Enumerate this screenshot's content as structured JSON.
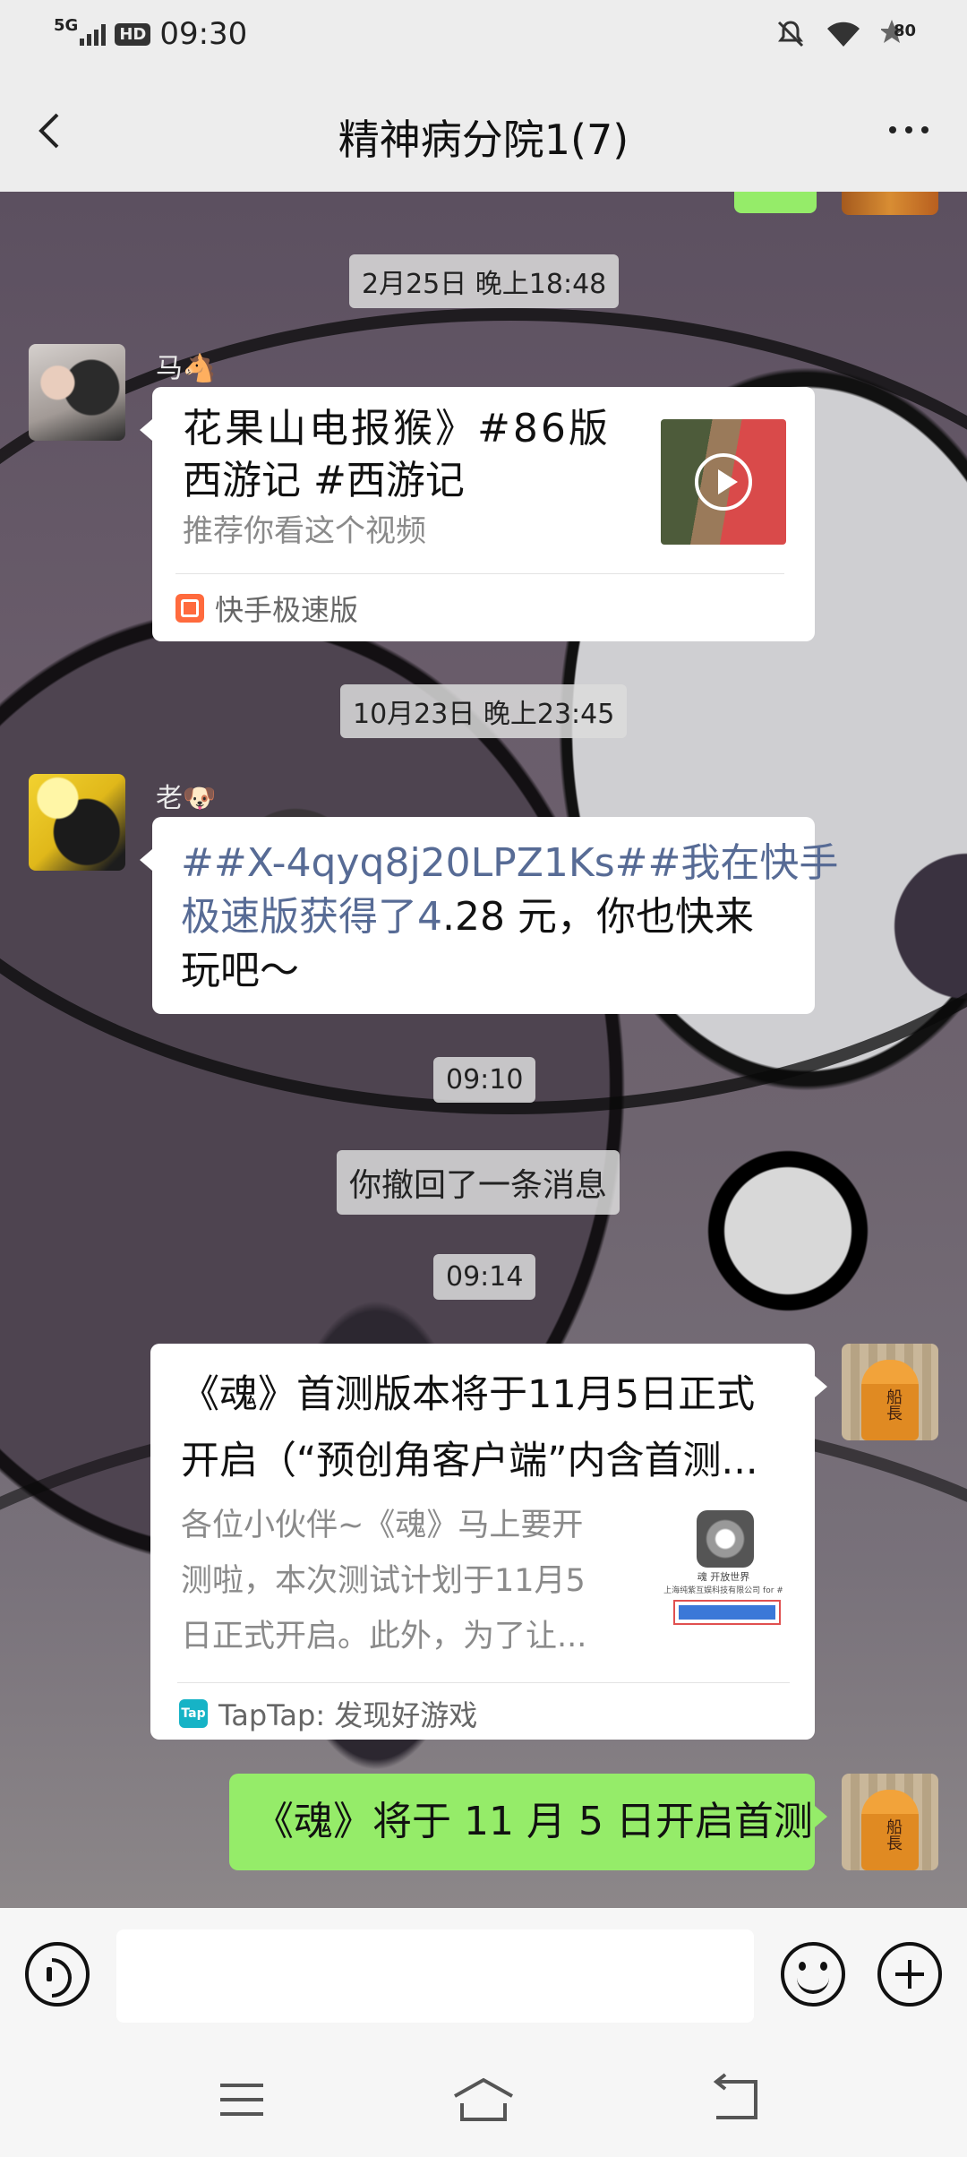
{
  "status_bar": {
    "network": "5G",
    "hd": "HD",
    "time": "09:30",
    "battery": "80"
  },
  "header": {
    "title": "精神病分院1(7)"
  },
  "messages": {
    "ts1": "2月25日 晚上18:48",
    "ma": {
      "sender": "马🐴",
      "title_line1": "花果山电报猴》#86版",
      "title_line2": "西游记 #西游记",
      "desc": "推荐你看这个视频",
      "source": "快手极速版"
    },
    "ts2": "10月23日 晚上23:45",
    "lao": {
      "sender": "老🐶",
      "link1": "##X-4qyq8j20LPZ1Ks#",
      "link2": "#我在快手",
      "link3": "极速版获得了4",
      "text_rest1": ".28 元，你也快来",
      "text_rest2": "玩吧～"
    },
    "ts3": "09:10",
    "recall": "你撤回了一条消息",
    "ts4": "09:14",
    "card2": {
      "title_line1": "《魂》首测版本将于11月5日正式",
      "title_line2": "开启（“预创角客户端”内含首测...",
      "desc_line1": "各位小伙伴~《魂》马上要开",
      "desc_line2": "测啦，本次测试计划于11月5",
      "desc_line3": "日正式开启。此外，为了让...",
      "thumb_name": "魂 开放世界",
      "thumb_corp": "上海纯紫互娱科技有限公司 for #",
      "source": "TapTap: 发现好游戏",
      "source_icon": "Tap"
    },
    "sent": "《魂》将于 11 月 5 日开启首测",
    "avatar_text": "船長"
  },
  "input": {
    "placeholder": ""
  }
}
